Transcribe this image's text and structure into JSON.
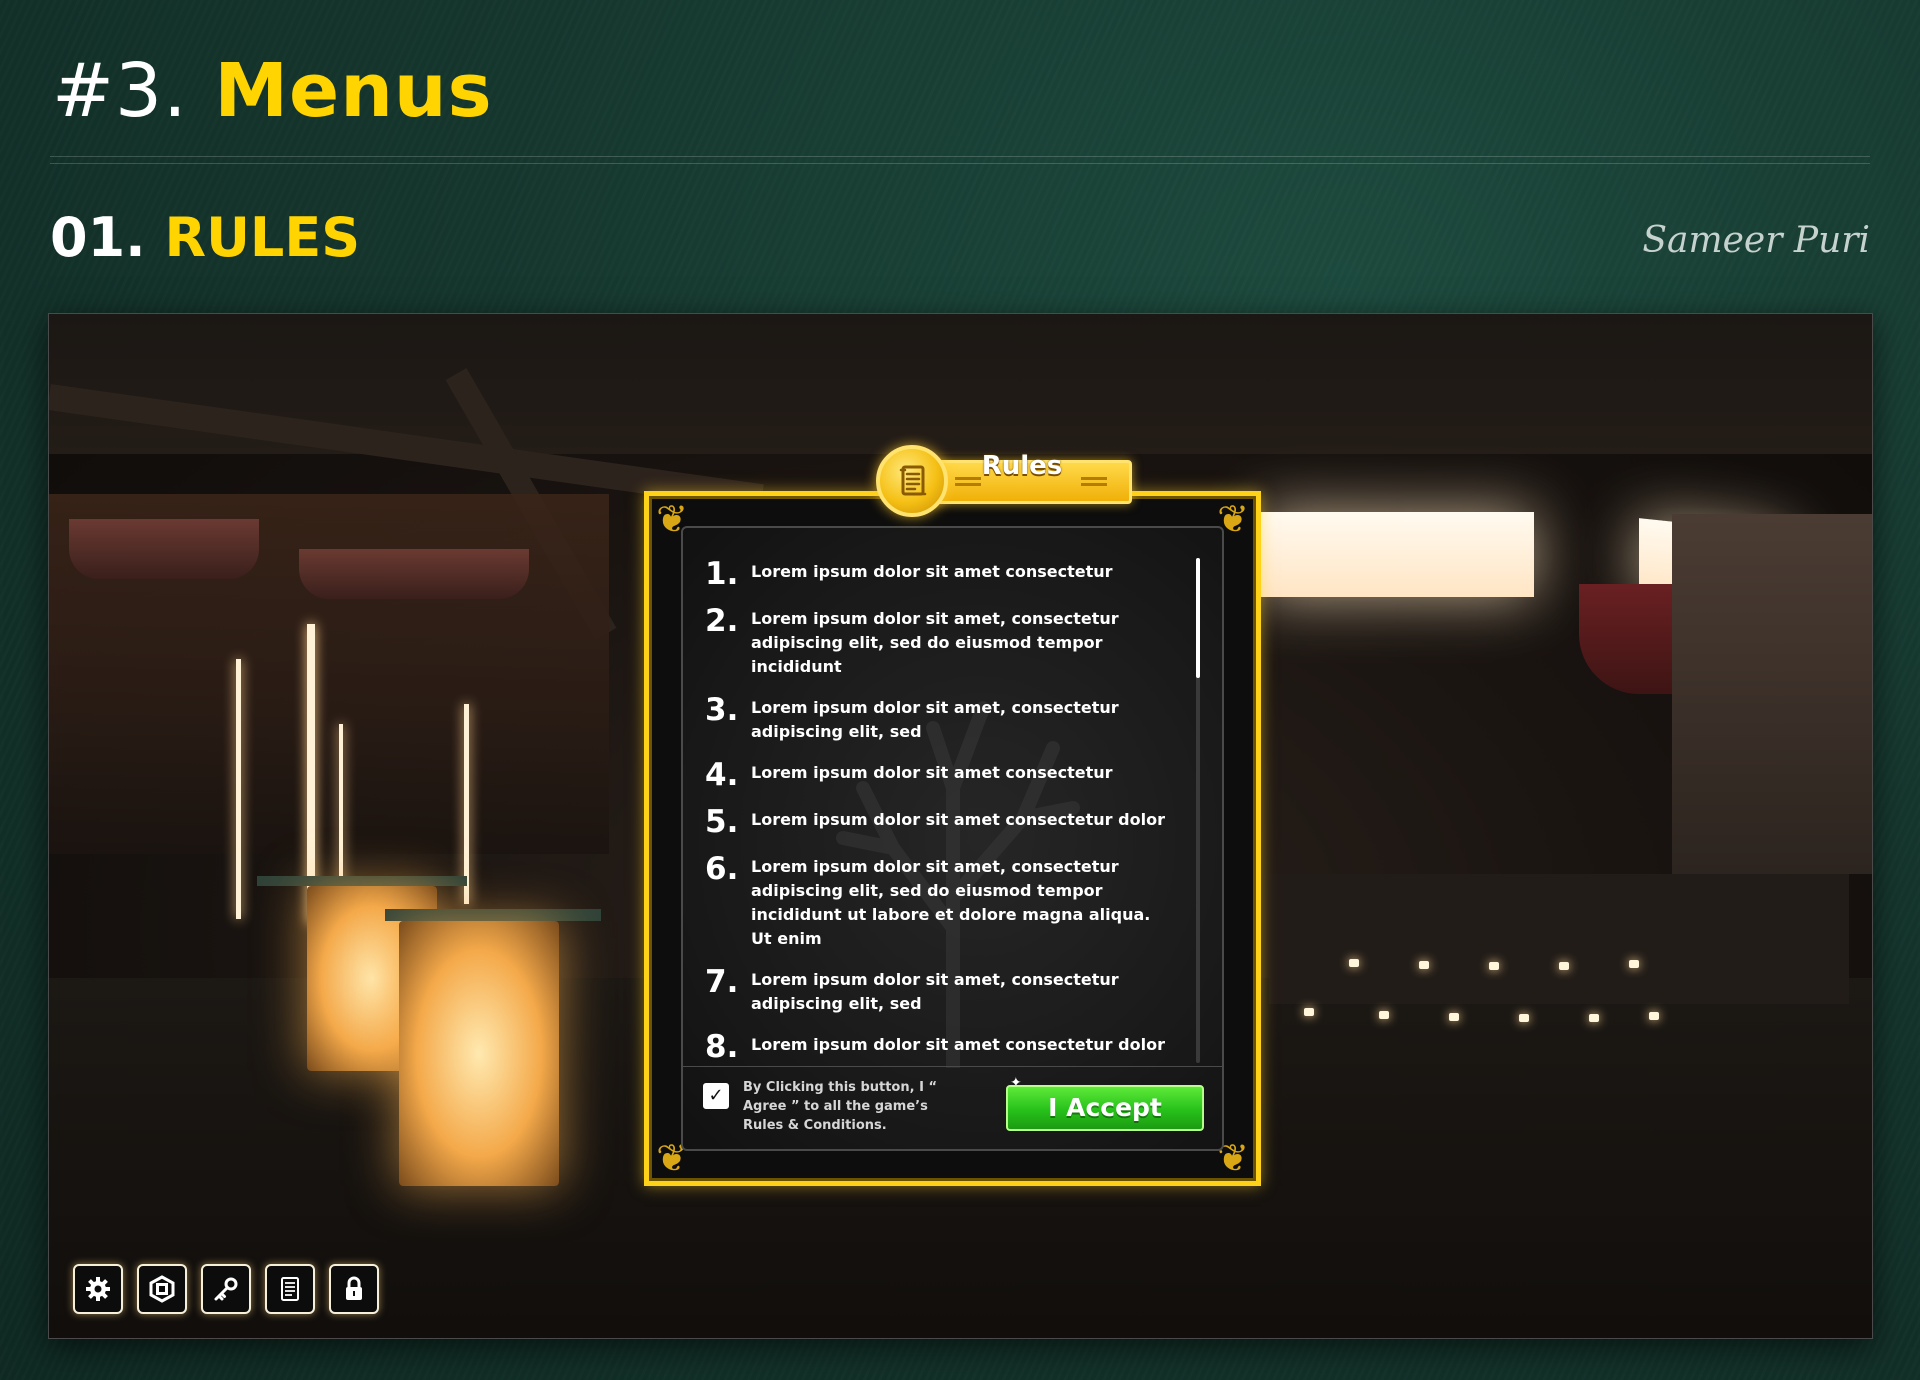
{
  "header": {
    "number": "#3.",
    "title": "Menus"
  },
  "section": {
    "number": "01.",
    "title": "RULES",
    "author": "Sameer Puri"
  },
  "dialog": {
    "title": "Rules",
    "rules": [
      {
        "n": "1.",
        "text": "Lorem ipsum dolor sit amet consectetur"
      },
      {
        "n": "2.",
        "text": "Lorem ipsum dolor sit amet, consectetur adipiscing elit, sed do eiusmod tempor incididunt"
      },
      {
        "n": "3.",
        "text": "Lorem ipsum dolor sit amet, consectetur adipiscing elit, sed"
      },
      {
        "n": "4.",
        "text": "Lorem ipsum dolor sit amet consectetur"
      },
      {
        "n": "5.",
        "text": "Lorem ipsum dolor sit amet consectetur dolor"
      },
      {
        "n": "6.",
        "text": "Lorem ipsum dolor sit amet, consectetur adipiscing elit, sed do eiusmod tempor incididunt ut labore et dolore magna aliqua. Ut enim"
      },
      {
        "n": "7.",
        "text": "Lorem ipsum dolor sit amet, consectetur adipiscing elit, sed"
      },
      {
        "n": "8.",
        "text": "Lorem ipsum dolor sit amet consectetur dolor"
      }
    ],
    "agree_text": "By Clicking this button, I “ Agree ” to all the game’s Rules & Conditions.",
    "checkbox_checked": true,
    "accept_label": "I Accept"
  },
  "toolbar": {
    "icons": [
      "gear-icon",
      "hexagon-icon",
      "key-icon",
      "document-icon",
      "lock-icon"
    ]
  },
  "colors": {
    "accent_yellow": "#ffd400",
    "dialog_border": "#ffd21a",
    "accept_green": "#27c11b",
    "page_background": "#15372e"
  }
}
